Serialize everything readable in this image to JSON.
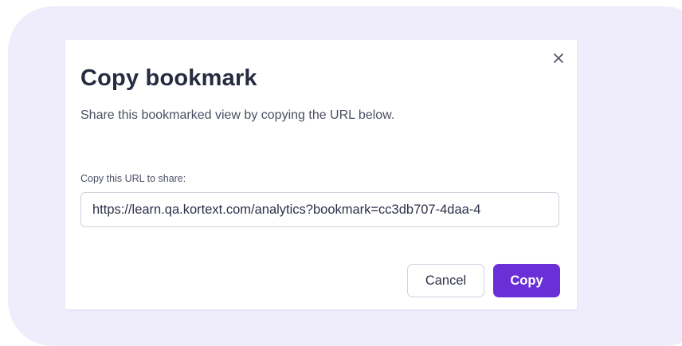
{
  "dialog": {
    "title": "Copy bookmark",
    "subtitle": "Share this bookmarked view by copying the URL below.",
    "close_icon": "close-icon",
    "url_field": {
      "label": "Copy this URL to share:",
      "value": "https://learn.qa.kortext.com/analytics?bookmark=cc3db707-4daa-4"
    },
    "buttons": {
      "cancel_label": "Cancel",
      "copy_label": "Copy"
    }
  },
  "colors": {
    "backdrop": "#efedfb",
    "dialog_bg": "#ffffff",
    "primary": "#6a2fd6",
    "title_text": "#262b40",
    "body_text": "#4b4f63",
    "border": "#cfd1dc"
  }
}
